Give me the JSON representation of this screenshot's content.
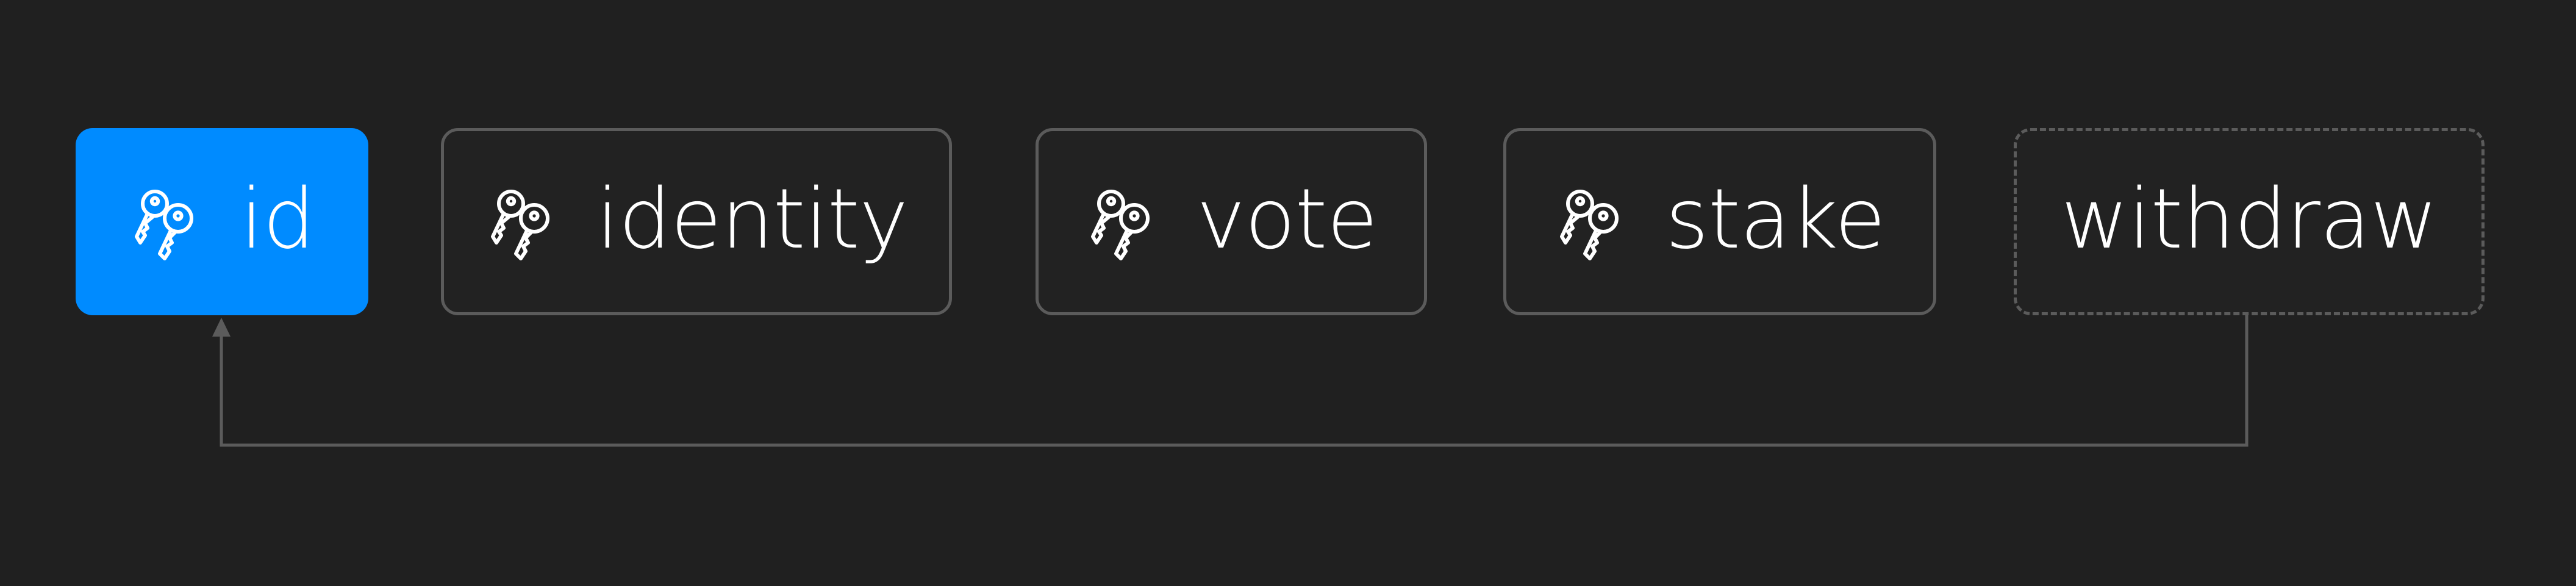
{
  "colors": {
    "background": "#202020",
    "active_fill": "#008bff",
    "border": "#5b5b5b",
    "text": "#ffffff"
  },
  "nodes": [
    {
      "label": "id",
      "icon": "keys-icon",
      "state": "active"
    },
    {
      "label": "identity",
      "icon": "keys-icon",
      "state": "solid"
    },
    {
      "label": "vote",
      "icon": "keys-icon",
      "state": "solid"
    },
    {
      "label": "stake",
      "icon": "keys-icon",
      "state": "solid"
    },
    {
      "label": "withdraw",
      "icon": "",
      "state": "dashed"
    }
  ],
  "edges": [
    {
      "from": "withdraw",
      "to": "id",
      "style": "arrow"
    }
  ]
}
